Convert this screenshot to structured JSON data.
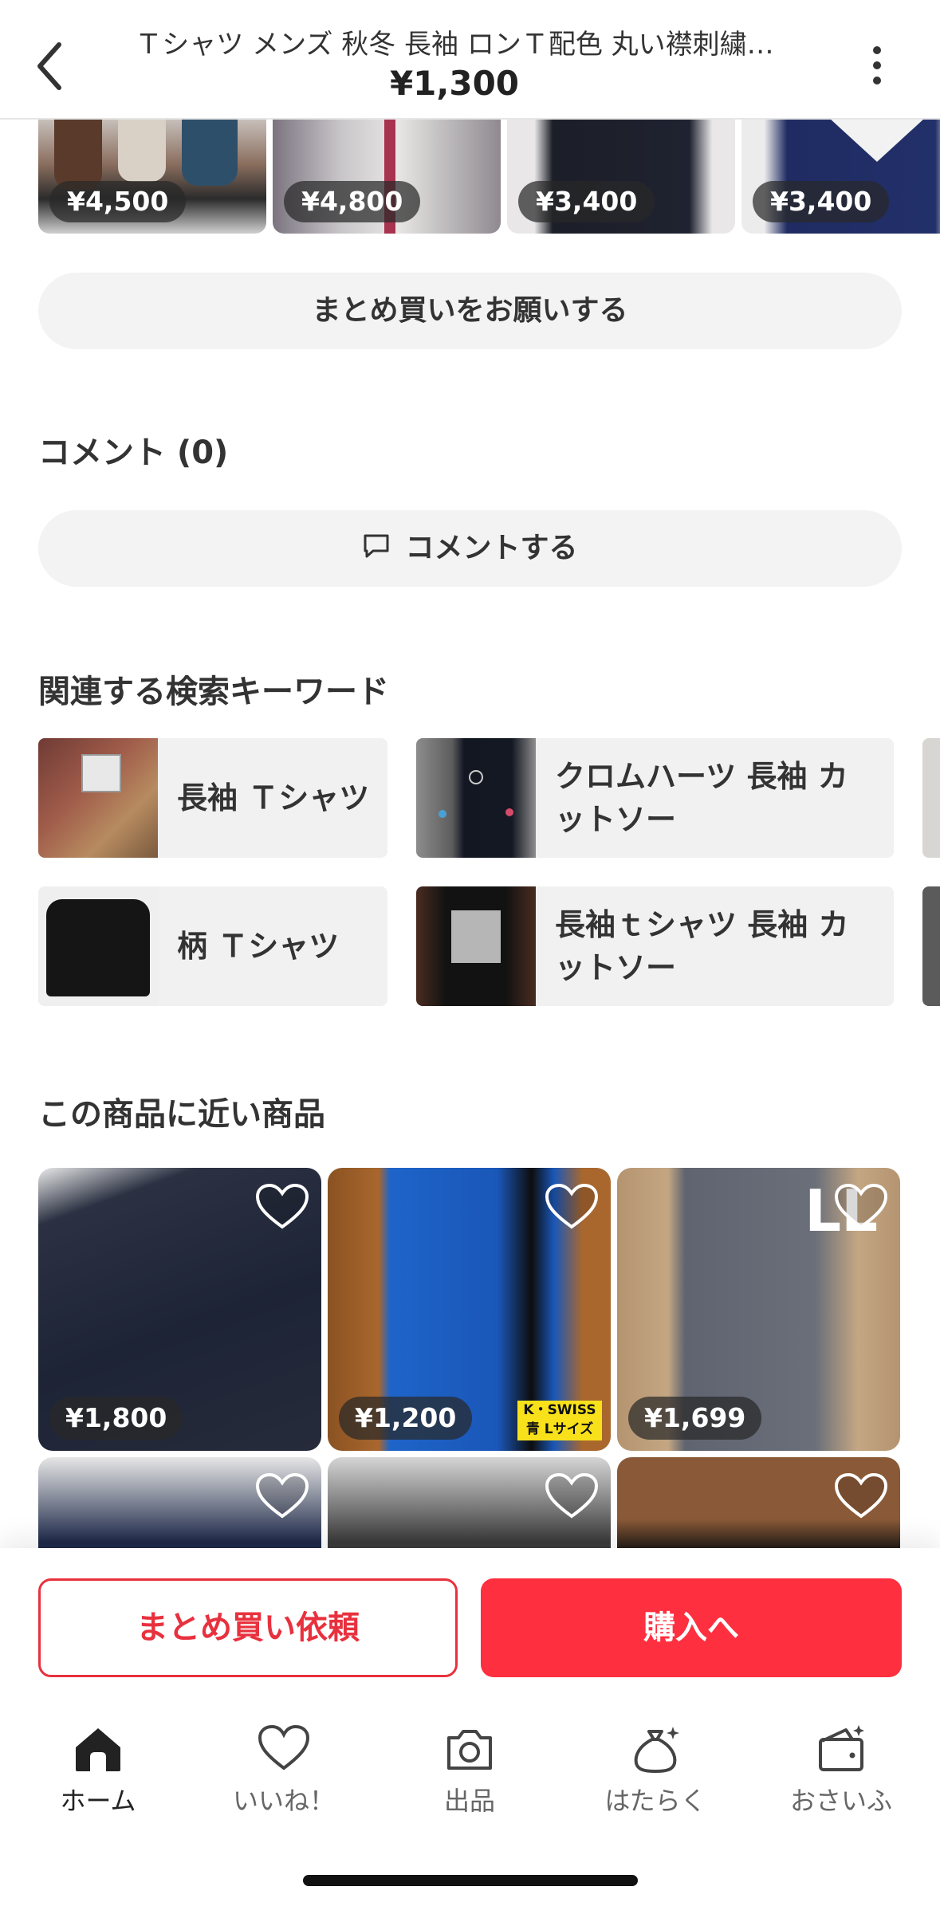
{
  "header": {
    "title": "Ｔシャツ メンズ 秋冬 長袖 ロンＴ配色 丸い襟刺繍…",
    "price": "¥1,300"
  },
  "thumbnails": [
    {
      "price": "¥4,500"
    },
    {
      "price": "¥4,800"
    },
    {
      "price": "¥3,400"
    },
    {
      "price": "¥3,400"
    }
  ],
  "bundle_request_label": "まとめ買いをお願いする",
  "comments": {
    "heading": "コメント (0)",
    "button_label": "コメントする"
  },
  "keywords": {
    "heading": "関連する検索キーワード",
    "items": [
      {
        "label": "長袖 Ｔシャツ"
      },
      {
        "label": "クロムハーツ 長袖 カットソー"
      },
      {
        "label": "柄 Ｔシャツ"
      },
      {
        "label": "長袖ｔシャツ 長袖 カットソー"
      }
    ]
  },
  "similar": {
    "heading": "この商品に近い商品",
    "items": [
      {
        "price": "¥1,800"
      },
      {
        "price": "¥1,200",
        "tag_line1": "K・SWISS",
        "tag_line2": "青 Lサイズ"
      },
      {
        "price": "¥1,699",
        "overlay_text": "LL"
      },
      {},
      {},
      {}
    ]
  },
  "actions": {
    "bundle_label": "まとめ買い依頼",
    "buy_label": "購入へ"
  },
  "tabbar": {
    "home": "ホーム",
    "likes": "いいね！",
    "sell": "出品",
    "work": "はたらく",
    "wallet": "おさいふ"
  },
  "colors": {
    "accent": "#fe2f3f",
    "outline_red": "#e8313e"
  }
}
